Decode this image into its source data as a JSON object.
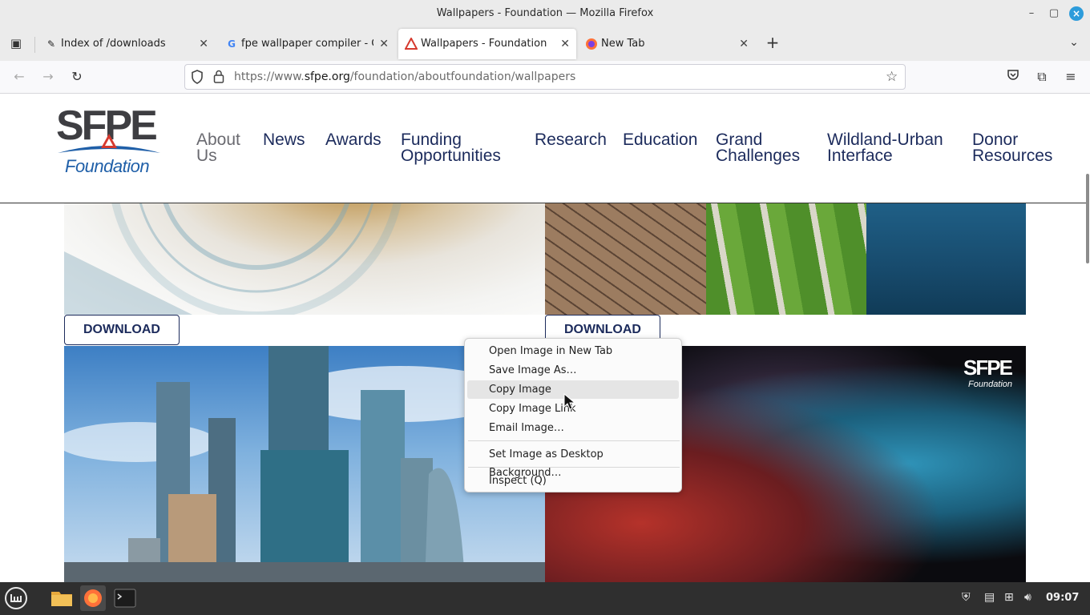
{
  "window": {
    "title": "Wallpapers - Foundation — Mozilla Firefox"
  },
  "tabs": [
    {
      "label": "Index of /downloads",
      "favicon": "pen-icon"
    },
    {
      "label": "fpe wallpaper compiler - Go",
      "favicon": "google-icon"
    },
    {
      "label": "Wallpapers - Foundation",
      "favicon": "sfpe-triangle-icon",
      "active": true
    },
    {
      "label": "New Tab",
      "favicon": "firefox-icon"
    }
  ],
  "url": {
    "prefix": "https://www.",
    "domain": "sfpe.org",
    "path": "/foundation/aboutfoundation/wallpapers"
  },
  "site": {
    "logo_text": "SFPE",
    "logo_sub": "Foundation",
    "nav": [
      {
        "line1": "About",
        "line2": "Us"
      },
      {
        "line1": "News",
        "line2": ""
      },
      {
        "line1": "Awards",
        "line2": ""
      },
      {
        "line1": "Funding",
        "line2": "Opportunities"
      },
      {
        "line1": "Research",
        "line2": ""
      },
      {
        "line1": "Education",
        "line2": ""
      },
      {
        "line1": "Grand",
        "line2": "Challenges"
      },
      {
        "line1": "Wildland-Urban",
        "line2": "Interface"
      },
      {
        "line1": "Donor",
        "line2": "Resources"
      }
    ],
    "download_label": "DOWNLOAD",
    "watermark_main": "SFPE",
    "watermark_sub": "Foundation"
  },
  "context_menu": {
    "items": [
      "Open Image in New Tab",
      "Save Image As…",
      "Copy Image",
      "Copy Image Link",
      "Email Image…",
      "Set Image as Desktop Background…",
      "Inspect (Q)"
    ]
  },
  "taskbar": {
    "clock": "09:07"
  },
  "colors": {
    "brand_navy": "#1c2b5c",
    "brand_blue": "#1f5fa8",
    "brand_red": "#d63a2f"
  }
}
